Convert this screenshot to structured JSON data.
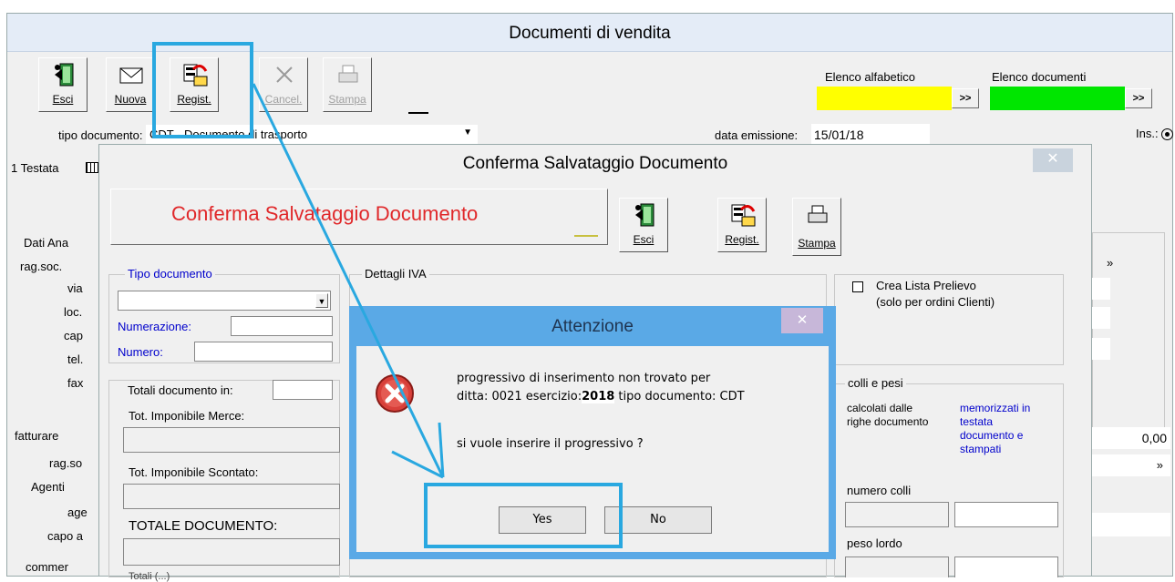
{
  "main_window": {
    "title": "Documenti di vendita",
    "toolbar": {
      "esci": "Esci",
      "nuova": "Nuova",
      "regist": "Regist.",
      "cancel": "Cancel.",
      "stampa": "Stampa"
    },
    "elenco_alfabetico": "Elenco alfabetico",
    "elenco_documenti": "Elenco documenti",
    "go_btn": ">>",
    "tipo_documento_label": "tipo documento:",
    "tipo_documento_value": "CDT - Documento di trasporto",
    "data_emissione_label": "data emissione:",
    "data_emissione_value": "15/01/18",
    "ins_label": "Ins.:",
    "tab_testata": "1 Testata",
    "left_labels": {
      "dati_ana": "Dati Ana",
      "rag_soc": "rag.soc.",
      "via": "via",
      "loc": "loc.",
      "cap": "cap",
      "tel": "tel.",
      "fax": "fax",
      "fatturare": "fatturare",
      "rag_so2": "rag.so",
      "agenti": "Agenti",
      "age": "age",
      "capo": "capo a",
      "commer": "commer"
    },
    "right_value": "0,00",
    "right_arrow": "»"
  },
  "save_dialog": {
    "title": "Conferma Salvataggio Documento",
    "banner": "Conferma Salvataggio Documento",
    "buttons": {
      "esci": "Esci",
      "regist": "Regist.",
      "stampa": "Stampa"
    },
    "tipo_documento": "Tipo documento",
    "numerazione": "Numerazione:",
    "numero": "Numero:",
    "dettagli_iva": "Dettagli IVA",
    "totali_label": "Totali documento in:",
    "tot_imponibile_merce": "Tot. Imponibile Merce:",
    "tot_imponibile_scontato": "Tot. Imponibile Scontato:",
    "totale_documento": "TOTALE DOCUMENTO:",
    "totale_footer": "Totali (...)",
    "crea_lista": "Crea Lista Prelievo",
    "crea_lista_sub": "(solo per ordini Clienti)",
    "colli_pesi": "colli e pesi",
    "calcolati": "calcolati dalle righe documento",
    "memorizzati": "memorizzati in testata documento e stampati",
    "numero_colli": "numero colli",
    "peso_lordo": "peso lordo"
  },
  "alert": {
    "title": "Attenzione",
    "message_line1": "progressivo di inserimento non trovato per",
    "message_line2_a": "ditta: 0021 esercizio:",
    "message_year": "2018",
    "message_line2_b": " tipo documento: CDT",
    "question": "si vuole inserire il progressivo ?",
    "yes": "Yes",
    "no": "No"
  },
  "colors": {
    "title_bar": "#e4ecf7",
    "alert_frame": "#5aa9e6",
    "highlight": "#29a8e0",
    "yellow": "#ffff00",
    "green": "#00e600",
    "banner_text": "#e0282a",
    "link_blue": "#0000cc"
  }
}
